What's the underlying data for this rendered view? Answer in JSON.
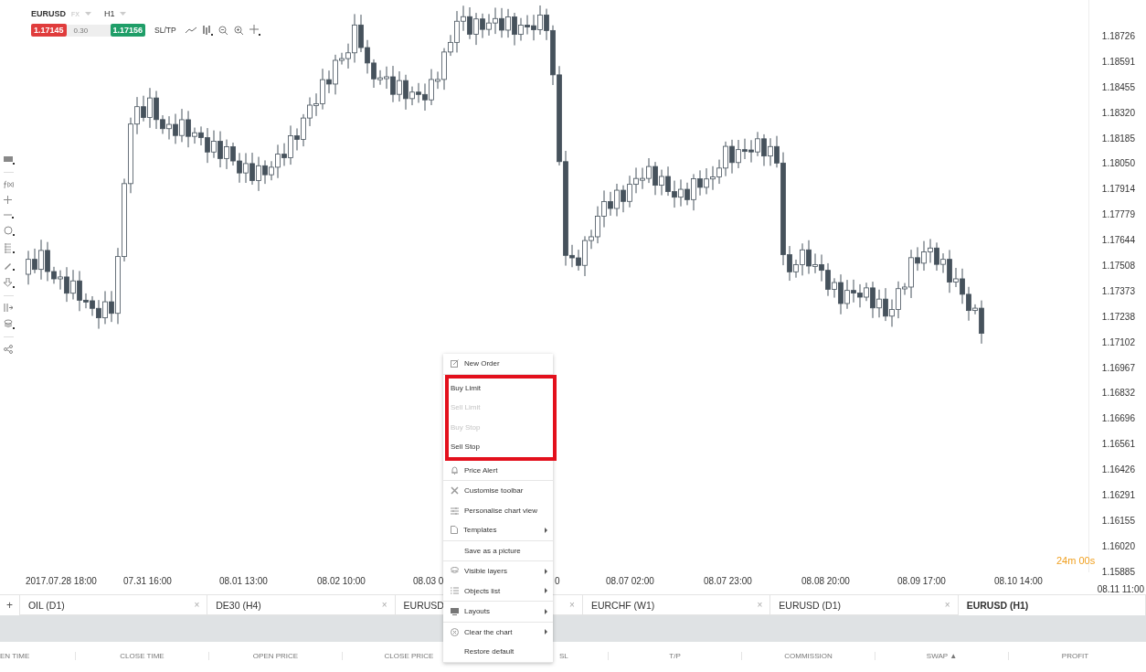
{
  "toolbar": {
    "symbol": "EURUSD",
    "market": "FX",
    "timeframe": "H1",
    "sell_price": "1.17145",
    "spread": "0.30",
    "buy_price": "1.17156",
    "sltp": "SL/TP"
  },
  "price_axis": [
    "1.18726",
    "1.18591",
    "1.18455",
    "1.18320",
    "1.18185",
    "1.18050",
    "1.17914",
    "1.17779",
    "1.17644",
    "1.17508",
    "1.17373",
    "1.17238",
    "1.17102",
    "1.16967",
    "1.16832",
    "1.16696",
    "1.16561",
    "1.16426",
    "1.16291",
    "1.16155",
    "1.16020",
    "1.15885"
  ],
  "time_axis": [
    "2017.07.28 18:00",
    "07.31 16:00",
    "08.01 13:00",
    "08.02 10:00",
    "08.03 0",
    "0",
    "08.07 02:00",
    "08.07 23:00",
    "08.08 20:00",
    "08.09 17:00",
    "08.10 14:00"
  ],
  "time_axis_last": "08.11 11:00",
  "countdown": "24m 00s",
  "chart_tabs": [
    {
      "label": "OIL (D1)",
      "selected": false
    },
    {
      "label": "DE30 (H4)",
      "selected": false
    },
    {
      "label": "EURUSD",
      "selected": false
    },
    {
      "label": "EURCHF (W1)",
      "selected": false
    },
    {
      "label": "EURUSD (D1)",
      "selected": false
    },
    {
      "label": "EURUSD (H1)",
      "selected": true
    }
  ],
  "add_tab": "+",
  "close_mark": "×",
  "table_columns": [
    "EN TIME",
    "CLOSE TIME",
    "OPEN PRICE",
    "CLOSE PRICE",
    "SL",
    "T/P",
    "COMMISSION",
    "SWAP ▲",
    "PROFIT"
  ],
  "context_menu": [
    {
      "highlighted": false,
      "items": [
        {
          "label": "New Order",
          "disabled": false,
          "submenu": false
        }
      ]
    },
    {
      "highlighted": true,
      "items": [
        {
          "label": "Buy Limit",
          "disabled": false,
          "submenu": false
        },
        {
          "label": "Sell Limit",
          "disabled": true,
          "submenu": false
        },
        {
          "label": "Buy Stop",
          "disabled": true,
          "submenu": false
        },
        {
          "label": "Sell Stop",
          "disabled": false,
          "submenu": false
        }
      ]
    },
    {
      "highlighted": false,
      "items": [
        {
          "label": "Price Alert",
          "disabled": false,
          "submenu": false
        }
      ]
    },
    {
      "highlighted": false,
      "items": [
        {
          "label": "Customise toolbar",
          "disabled": false,
          "submenu": false
        },
        {
          "label": "Personalise chart view",
          "disabled": false,
          "submenu": false
        },
        {
          "label": "Templates",
          "disabled": false,
          "submenu": true
        }
      ]
    },
    {
      "highlighted": false,
      "items": [
        {
          "label": "Save as a picture",
          "disabled": false,
          "submenu": false
        }
      ]
    },
    {
      "highlighted": false,
      "items": [
        {
          "label": "Visible layers",
          "disabled": false,
          "submenu": true
        },
        {
          "label": "Objects list",
          "disabled": false,
          "submenu": true
        }
      ]
    },
    {
      "highlighted": false,
      "items": [
        {
          "label": "Layouts",
          "disabled": false,
          "submenu": true
        }
      ]
    },
    {
      "highlighted": false,
      "items": [
        {
          "label": "Clear the chart",
          "disabled": false,
          "submenu": true
        },
        {
          "label": "Restore default",
          "disabled": false,
          "submenu": false
        }
      ]
    }
  ]
}
